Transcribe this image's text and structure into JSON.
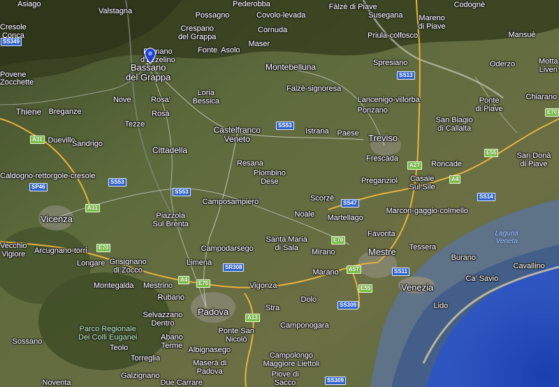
{
  "map": {
    "type": "satellite",
    "places": [
      {
        "name": "Asiago"
      },
      {
        "name": "Valstagna"
      },
      {
        "name": "Pederobba"
      },
      {
        "name": "Fàlzè di Piave"
      },
      {
        "name": "Codognè"
      },
      {
        "name": "Cresole\nConca"
      },
      {
        "name": "Possagno"
      },
      {
        "name": "Covolo-levada"
      },
      {
        "name": "Susegana"
      },
      {
        "name": "Mareno\ndi Piave"
      },
      {
        "name": "Crespano\ndel Grappa"
      },
      {
        "name": "Cornuda"
      },
      {
        "name": "Priula-colfosco"
      },
      {
        "name": "Mansuè"
      },
      {
        "name": "Romano\nd'Ezzelino"
      },
      {
        "name": "Maser"
      },
      {
        "name": "Fonte"
      },
      {
        "name": "Asolo"
      },
      {
        "name": "Spresiano"
      },
      {
        "name": "Oderzo"
      },
      {
        "name": "Motta\nLiven"
      },
      {
        "name": "Bassano\ndel Grappa"
      },
      {
        "name": "Montebelluna"
      },
      {
        "name": "Povene"
      },
      {
        "name": "Zocchette"
      },
      {
        "name": "Loria\nBessica"
      },
      {
        "name": "Falzè-signoresa"
      },
      {
        "name": "Lancenigo-villorba"
      },
      {
        "name": "Ponte\ndi Piave"
      },
      {
        "name": "Chiarano"
      },
      {
        "name": "Nove"
      },
      {
        "name": "Rosa'"
      },
      {
        "name": "Rosà"
      },
      {
        "name": "Thiene"
      },
      {
        "name": "Breganze"
      },
      {
        "name": "Ponzano"
      },
      {
        "name": "San Biagio\ndi Callalta"
      },
      {
        "name": "Tezze"
      },
      {
        "name": "Castelfranco\nVeneto"
      },
      {
        "name": "Istrana"
      },
      {
        "name": "Paese"
      },
      {
        "name": "Treviso"
      },
      {
        "name": "Dueville"
      },
      {
        "name": "Sandrigo"
      },
      {
        "name": "Cittadella"
      },
      {
        "name": "San Donà\ndi Piave"
      },
      {
        "name": "Frescada"
      },
      {
        "name": "Roncade"
      },
      {
        "name": "Resana"
      },
      {
        "name": "Piombino\nDese"
      },
      {
        "name": "Caldogno-rettorgole-cresole"
      },
      {
        "name": "Preganziol"
      },
      {
        "name": "Casale\nSul Sile"
      },
      {
        "name": "Camposampiero"
      },
      {
        "name": "Scorzè"
      },
      {
        "name": "Noale"
      },
      {
        "name": "Martellago"
      },
      {
        "name": "Marcon-gaggio-colmello"
      },
      {
        "name": "Vicenza"
      },
      {
        "name": "Piazzola\nSul Brenta"
      },
      {
        "name": "Favorita"
      },
      {
        "name": "Laguna\nVeneta"
      },
      {
        "name": "Arcugnano-torri"
      },
      {
        "name": "Santa Maria\ndi Sala"
      },
      {
        "name": "Vecchio\nVigiore"
      },
      {
        "name": "Campodarsego"
      },
      {
        "name": "Mestre"
      },
      {
        "name": "Tessera"
      },
      {
        "name": "Mirano"
      },
      {
        "name": "Burano"
      },
      {
        "name": "Longare"
      },
      {
        "name": "Grisignano\ndi Zocco"
      },
      {
        "name": "Limena"
      },
      {
        "name": "Cavallino"
      },
      {
        "name": "Marano"
      },
      {
        "name": "Ca' Savio"
      },
      {
        "name": "Montegalda"
      },
      {
        "name": "Mestrino"
      },
      {
        "name": "Vigonza"
      },
      {
        "name": "Venezia"
      },
      {
        "name": "Rubano"
      },
      {
        "name": "Dolo"
      },
      {
        "name": "Lido"
      },
      {
        "name": "Selvazzano\nDentro"
      },
      {
        "name": "Padova"
      },
      {
        "name": "Stra"
      },
      {
        "name": "Parco Regionale\nDei Colli Euganei"
      },
      {
        "name": "Abano\nTerme"
      },
      {
        "name": "Ponte San\nNicolò"
      },
      {
        "name": "Camponogara"
      },
      {
        "name": "Sossano"
      },
      {
        "name": "Teolo"
      },
      {
        "name": "Albignasego"
      },
      {
        "name": "Torreglia"
      },
      {
        "name": "Campolongo\nMaggiore Liettoli"
      },
      {
        "name": "Maserà di\nPadova"
      },
      {
        "name": "Galzignano"
      },
      {
        "name": "Noventa"
      },
      {
        "name": "Due Carrare"
      },
      {
        "name": "Piove di\nSacco"
      }
    ],
    "roads": [
      {
        "ref": "SS349",
        "kind": "ss"
      },
      {
        "ref": "SS13",
        "kind": "ss"
      },
      {
        "ref": "SS53",
        "kind": "ss"
      },
      {
        "ref": "SS53",
        "kind": "ss"
      },
      {
        "ref": "SS53",
        "kind": "ss"
      },
      {
        "ref": "A31",
        "kind": "a"
      },
      {
        "ref": "A31",
        "kind": "a"
      },
      {
        "ref": "E55",
        "kind": "e"
      },
      {
        "ref": "A27",
        "kind": "a"
      },
      {
        "ref": "A4",
        "kind": "a"
      },
      {
        "ref": "SP46",
        "kind": "sp"
      },
      {
        "ref": "SS47",
        "kind": "ss"
      },
      {
        "ref": "A4",
        "kind": "a"
      },
      {
        "ref": "SS14",
        "kind": "ss"
      },
      {
        "ref": "E70",
        "kind": "e"
      },
      {
        "ref": "E70",
        "kind": "e"
      },
      {
        "ref": "SS11",
        "kind": "ss"
      },
      {
        "ref": "SR308",
        "kind": "ss"
      },
      {
        "ref": "A57",
        "kind": "a"
      },
      {
        "ref": "A4",
        "kind": "a"
      },
      {
        "ref": "E70",
        "kind": "e"
      },
      {
        "ref": "E55",
        "kind": "e"
      },
      {
        "ref": "SS309",
        "kind": "ss"
      },
      {
        "ref": "A13",
        "kind": "a"
      },
      {
        "ref": "SS309",
        "kind": "ss"
      },
      {
        "ref": "E70",
        "kind": "e"
      }
    ],
    "marker": {
      "color": "#1f3fd6"
    }
  }
}
